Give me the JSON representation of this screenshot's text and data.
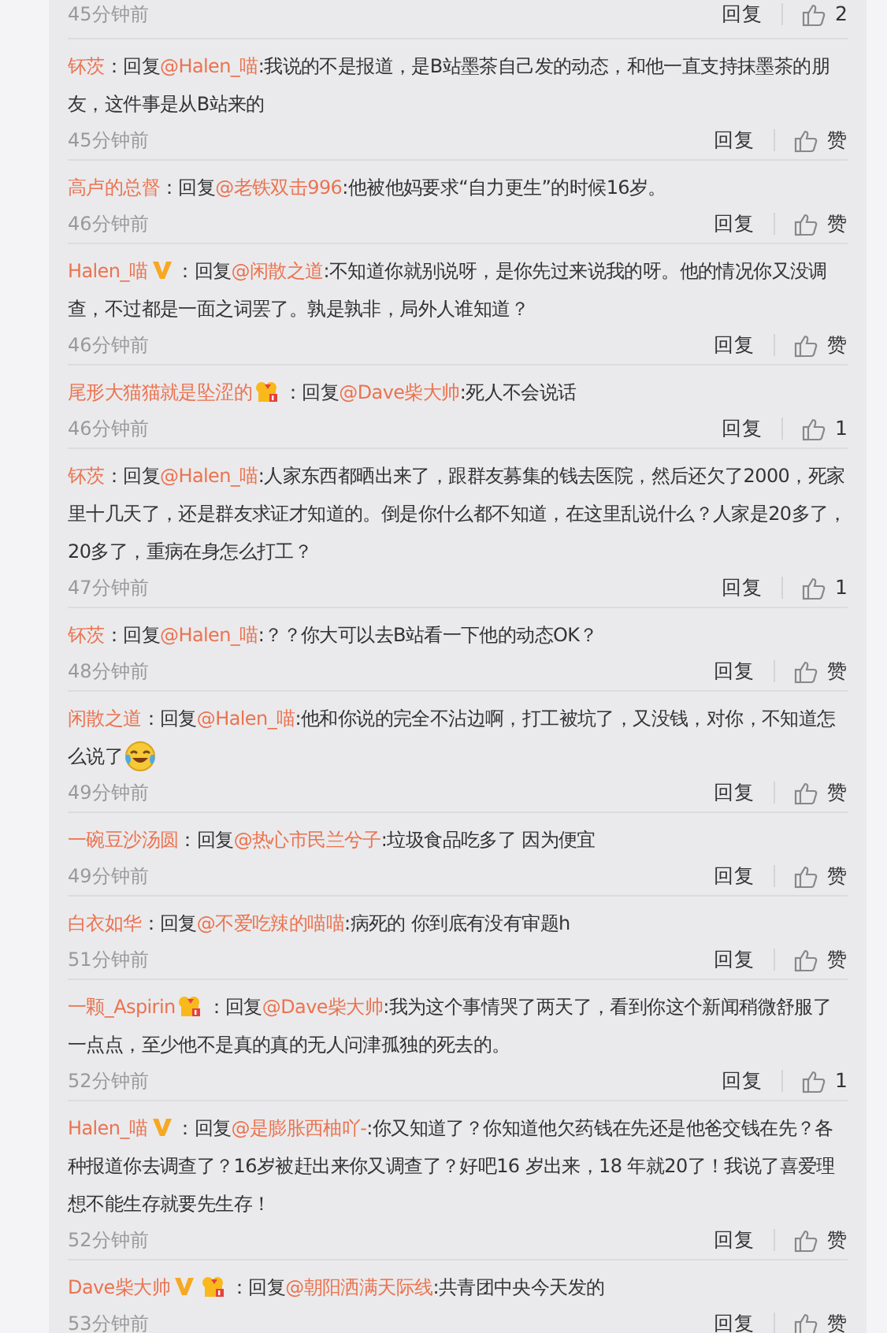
{
  "comments": [
    {
      "partial": true,
      "time": "45分钟前",
      "reply_label": "回复",
      "like_label": "2"
    },
    {
      "user": "钚茨",
      "reply_prefix": "：回复",
      "mention": "@Halen_喵",
      "text": ":我说的不是报道，是B站墨茶自己发的动态，和他一直支持抹墨茶的朋友，这件事是从B站来的",
      "time": "45分钟前",
      "reply_label": "回复",
      "like_label": "赞"
    },
    {
      "user": "高卢的总督",
      "reply_prefix": "：回复",
      "mention": "@老铁双击996",
      "text": ":他被他妈要求“自力更生”的时候16岁。",
      "time": "46分钟前",
      "reply_label": "回复",
      "like_label": "赞"
    },
    {
      "user": "Halen_喵",
      "badges": [
        {
          "kind": "verified"
        }
      ],
      "reply_prefix": "：回复",
      "mention": "@闲散之道",
      "text": ":不知道你就别说呀，是你先过来说我的呀。他的情况你又没调查，不过都是一面之词罢了。孰是孰非，局外人谁知道？",
      "time": "46分钟前",
      "reply_label": "回复",
      "like_label": "赞"
    },
    {
      "user": "尾形大猫猫就是坠涩的",
      "badges": [
        {
          "kind": "vip"
        }
      ],
      "reply_prefix": "：回复",
      "mention": "@Dave柴大帅",
      "text": ":死人不会说话",
      "time": "46分钟前",
      "reply_label": "回复",
      "like_label": "1"
    },
    {
      "user": "钚茨",
      "reply_prefix": "：回复",
      "mention": "@Halen_喵",
      "text": ":人家东西都晒出来了，跟群友募集的钱去医院，然后还欠了2000，死家里十几天了，还是群友求证才知道的。倒是你什么都不知道，在这里乱说什么？人家是20多了，20多了，重病在身怎么打工？",
      "time": "47分钟前",
      "reply_label": "回复",
      "like_label": "1"
    },
    {
      "user": "钚茨",
      "reply_prefix": "：回复",
      "mention": "@Halen_喵",
      "text": ":？？你大可以去B站看一下他的动态OK？",
      "time": "48分钟前",
      "reply_label": "回复",
      "like_label": "赞"
    },
    {
      "user": "闲散之道",
      "reply_prefix": "：回复",
      "mention": "@Halen_喵",
      "text": ":他和你说的完全不沾边啊，打工被坑了，又没钱，对你，不知道怎么说了",
      "trailing_emoji": true,
      "time": "49分钟前",
      "reply_label": "回复",
      "like_label": "赞"
    },
    {
      "user": "一碗豆沙汤圆",
      "reply_prefix": "：回复",
      "mention": "@热心市民兰兮子",
      "text": ":垃圾食品吃多了 因为便宜",
      "time": "49分钟前",
      "reply_label": "回复",
      "like_label": "赞"
    },
    {
      "user": "白衣如华",
      "reply_prefix": "：回复",
      "mention": "@不爱吃辣的喵喵",
      "text": ":病死的 你到底有没有审题h",
      "time": "51分钟前",
      "reply_label": "回复",
      "like_label": "赞"
    },
    {
      "user": "一颗_Aspirin",
      "badges": [
        {
          "kind": "vip"
        }
      ],
      "reply_prefix": "：回复",
      "mention": "@Dave柴大帅",
      "text": ":我为这个事情哭了两天了，看到你这个新闻稍微舒服了一点点，至少他不是真的真的无人问津孤独的死去的。",
      "time": "52分钟前",
      "reply_label": "回复",
      "like_label": "1"
    },
    {
      "user": "Halen_喵",
      "badges": [
        {
          "kind": "verified"
        }
      ],
      "reply_prefix": "：回复",
      "mention": "@是膨胀西柚吖-",
      "text": ":你又知道了？你知道他欠药钱在先还是他爸交钱在先？各种报道你去调查了？16岁被赶出来你又调查了？好吧16 岁出来，18 年就20了！我说了喜爱理想不能生存就要先生存！",
      "time": "52分钟前",
      "reply_label": "回复",
      "like_label": "赞"
    },
    {
      "user": "Dave柴大帅",
      "badges": [
        {
          "kind": "verified"
        },
        {
          "kind": "vip"
        }
      ],
      "reply_prefix": "：回复",
      "mention": "@朝阳洒满天际线",
      "text": ":共青团中央今天发的",
      "time": "53分钟前",
      "reply_label": "回复",
      "like_label": "赞"
    }
  ]
}
